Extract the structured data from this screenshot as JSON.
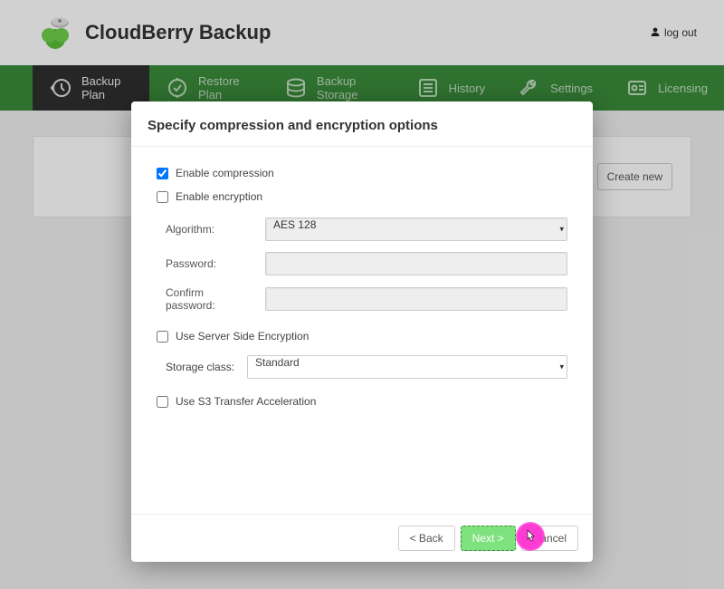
{
  "header": {
    "app_title": "CloudBerry Backup",
    "logout_label": "log out"
  },
  "nav": {
    "items": [
      {
        "label": "Backup Plan",
        "icon": "clock-restore-icon",
        "active": true
      },
      {
        "label": "Restore Plan",
        "icon": "restore-icon",
        "active": false
      },
      {
        "label": "Backup Storage",
        "icon": "storage-icon",
        "active": false
      },
      {
        "label": "History",
        "icon": "list-icon",
        "active": false
      },
      {
        "label": "Settings",
        "icon": "wrench-icon",
        "active": false
      },
      {
        "label": "Licensing",
        "icon": "license-icon",
        "active": false
      }
    ]
  },
  "page": {
    "create_button": "Create new"
  },
  "modal": {
    "title": "Specify compression and encryption options",
    "enable_compression_label": "Enable compression",
    "enable_compression_checked": true,
    "enable_encryption_label": "Enable encryption",
    "enable_encryption_checked": false,
    "algorithm_label": "Algorithm:",
    "algorithm_value": "AES 128",
    "password_label": "Password:",
    "password_value": "",
    "confirm_password_label": "Confirm password:",
    "confirm_password_value": "",
    "use_sse_label": "Use Server Side Encryption",
    "use_sse_checked": false,
    "storage_class_label": "Storage class:",
    "storage_class_value": "Standard",
    "use_s3_accel_label": "Use S3 Transfer Acceleration",
    "use_s3_accel_checked": false,
    "buttons": {
      "back": "< Back",
      "next": "Next >",
      "cancel": "Cancel"
    }
  }
}
